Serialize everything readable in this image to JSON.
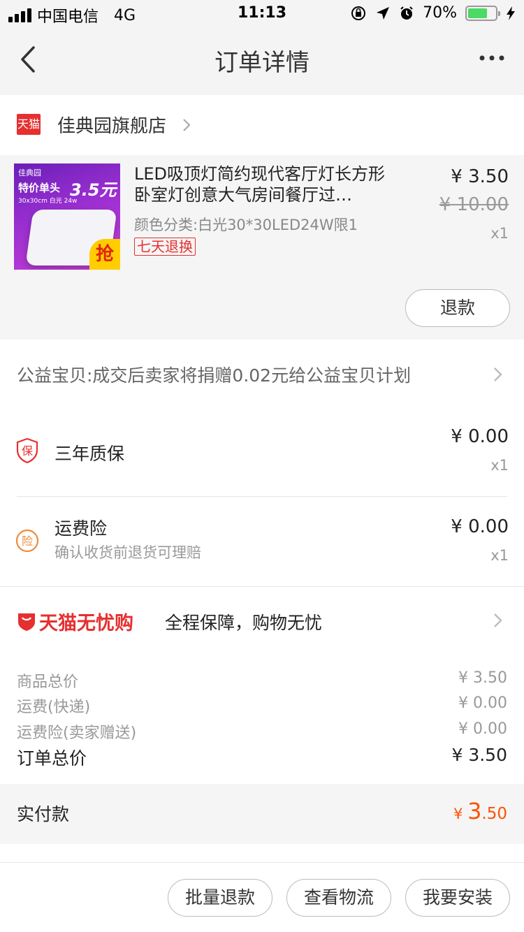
{
  "status_bar": {
    "carrier": "中国电信",
    "network": "4G",
    "time": "11:13",
    "battery": "70%",
    "battery_level": 0.7
  },
  "nav": {
    "title": "订单详情"
  },
  "store": {
    "badge": "天猫",
    "name": "佳典园旗舰店"
  },
  "product": {
    "thumb_brand": "佳典园",
    "thumb_promo": "特价单头",
    "thumb_price": "3.5元",
    "thumb_spec": "30x30cm  白光  24w",
    "thumb_badge": "抢",
    "title": "LED吸顶灯简约现代客厅灯长方形卧室灯创意大气房间餐厅过…",
    "sku": "颜色分类:白光30*30LED24W限1",
    "tag": "七天退换",
    "price": "¥ 3.50",
    "original_price": "¥ 10.00",
    "qty": "x1",
    "refund_label": "退款"
  },
  "charity": {
    "text": "公益宝贝:成交后卖家将捐赠0.02元给公益宝贝计划"
  },
  "services": [
    {
      "icon_char": "保",
      "name": "三年质保",
      "sub": "",
      "price": "¥ 0.00",
      "qty": "x1"
    },
    {
      "icon_char": "险",
      "name": "运费险",
      "sub": "确认收货前退货可理赔",
      "price": "¥ 0.00",
      "qty": "x1"
    }
  ],
  "worry_free": {
    "brand": "天猫无忧购",
    "desc": "全程保障，购物无忧"
  },
  "summary": {
    "goods_label": "商品总价",
    "goods_value": "¥ 3.50",
    "shipping_label": "运费(快递)",
    "shipping_value": "¥ 0.00",
    "insurance_label": "运费险(卖家赠送)",
    "insurance_value": "¥ 0.00",
    "total_label": "订单总价",
    "total_value": "¥ 3.50"
  },
  "paid": {
    "label": "实付款",
    "currency": "¥ ",
    "integer": "3",
    "decimal": ".50"
  },
  "actions": {
    "batch_refund": "批量退款",
    "view_logistics": "查看物流",
    "install": "我要安装"
  },
  "colors": {
    "brand_red": "#e5302f",
    "paid_orange": "#ff5000",
    "battery_green": "#4cd964"
  }
}
